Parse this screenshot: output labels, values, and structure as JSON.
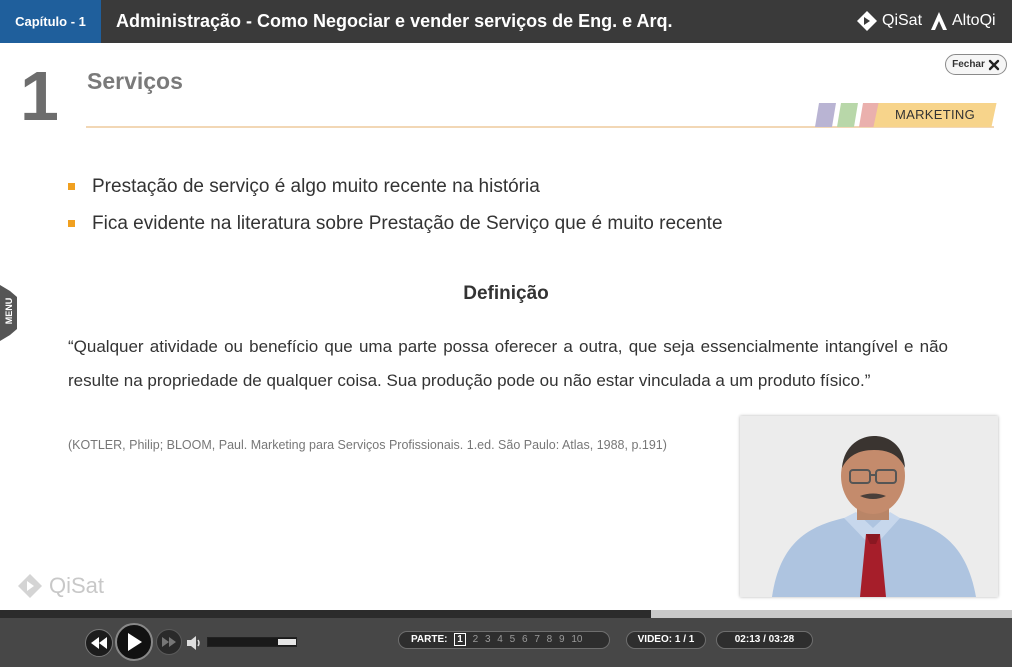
{
  "header": {
    "chapter_label": "Capítulo - 1",
    "course_title": "Administração - Como Negociar e vender serviços de Eng. e Arq.",
    "brand_qisat": "QiSat",
    "brand_altoqi": "AltoQi"
  },
  "slide": {
    "number": "1",
    "title": "Serviços",
    "close_label": "Fechar",
    "category_tag": "MARKETING",
    "tag_stripe_colors": [
      "#b9b4d3",
      "#b8d7a9",
      "#eab0ad"
    ],
    "tag_color": "#f7d48b",
    "bullet_color": "#f0a020",
    "bullets": [
      "Prestação de serviço é algo muito recente na história",
      "Fica evidente na literatura sobre Prestação de Serviço que é muito recente"
    ],
    "definition_title": "Definição",
    "definition_text": "“Qualquer atividade ou benefício que uma parte possa oferecer a outra, que seja essencialmente intangível e não resulte na propriedade de qualquer coisa. Sua produção pode ou não estar vinculada a um produto físico.”",
    "citation": "(KOTLER, Philip; BLOOM, Paul. Marketing para Serviços Profissionais. 1.ed. São Paulo: Atlas, 1988, p.191)",
    "side_menu_label": "MENU",
    "watermark": "QiSat"
  },
  "player": {
    "progress_fraction": 0.643,
    "parts_label": "PARTE:",
    "parts": [
      "1",
      "2",
      "3",
      "4",
      "5",
      "6",
      "7",
      "8",
      "9",
      "10"
    ],
    "current_part": "1",
    "video_label": "VIDEO:",
    "video_count": "1 / 1",
    "time": "02:13 / 03:28",
    "volume_fraction": 0.2
  }
}
